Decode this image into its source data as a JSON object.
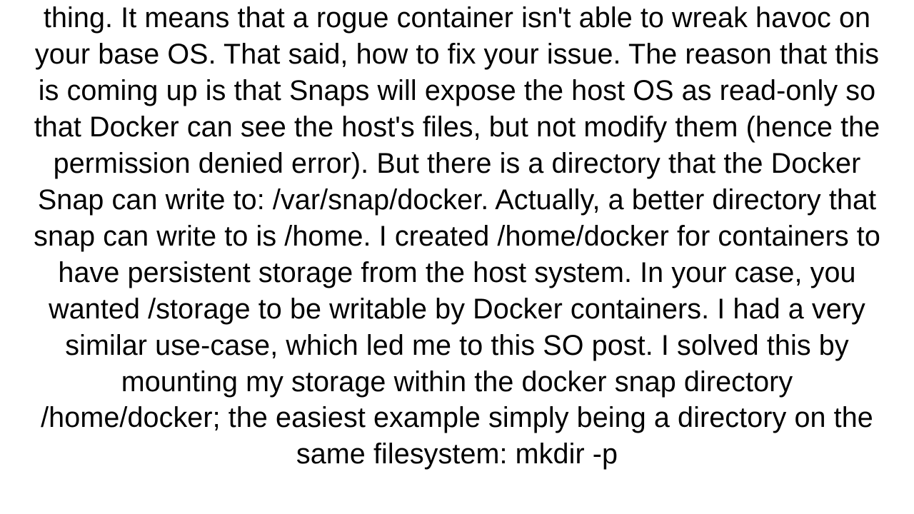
{
  "body": {
    "paragraph": "thing.  It means that a rogue container isn't able to wreak havoc on your base OS.  That said, how to fix your issue.  The reason that this is coming up is that Snaps will expose the host OS as read-only so that Docker can see the host's files, but not modify them (hence the permission denied error).  But there is a directory that the Docker Snap can write to: /var/snap/docker.  Actually, a better directory that snap can write to is /home.  I created /home/docker for containers to have persistent storage from the host system.  In your case, you wanted /storage to be writable by Docker containers.  I had a very similar use-case, which led me to this SO post.  I solved this by mounting my storage within the docker snap directory /home/docker;  the easiest example simply being a directory on the same filesystem: mkdir -p"
  }
}
